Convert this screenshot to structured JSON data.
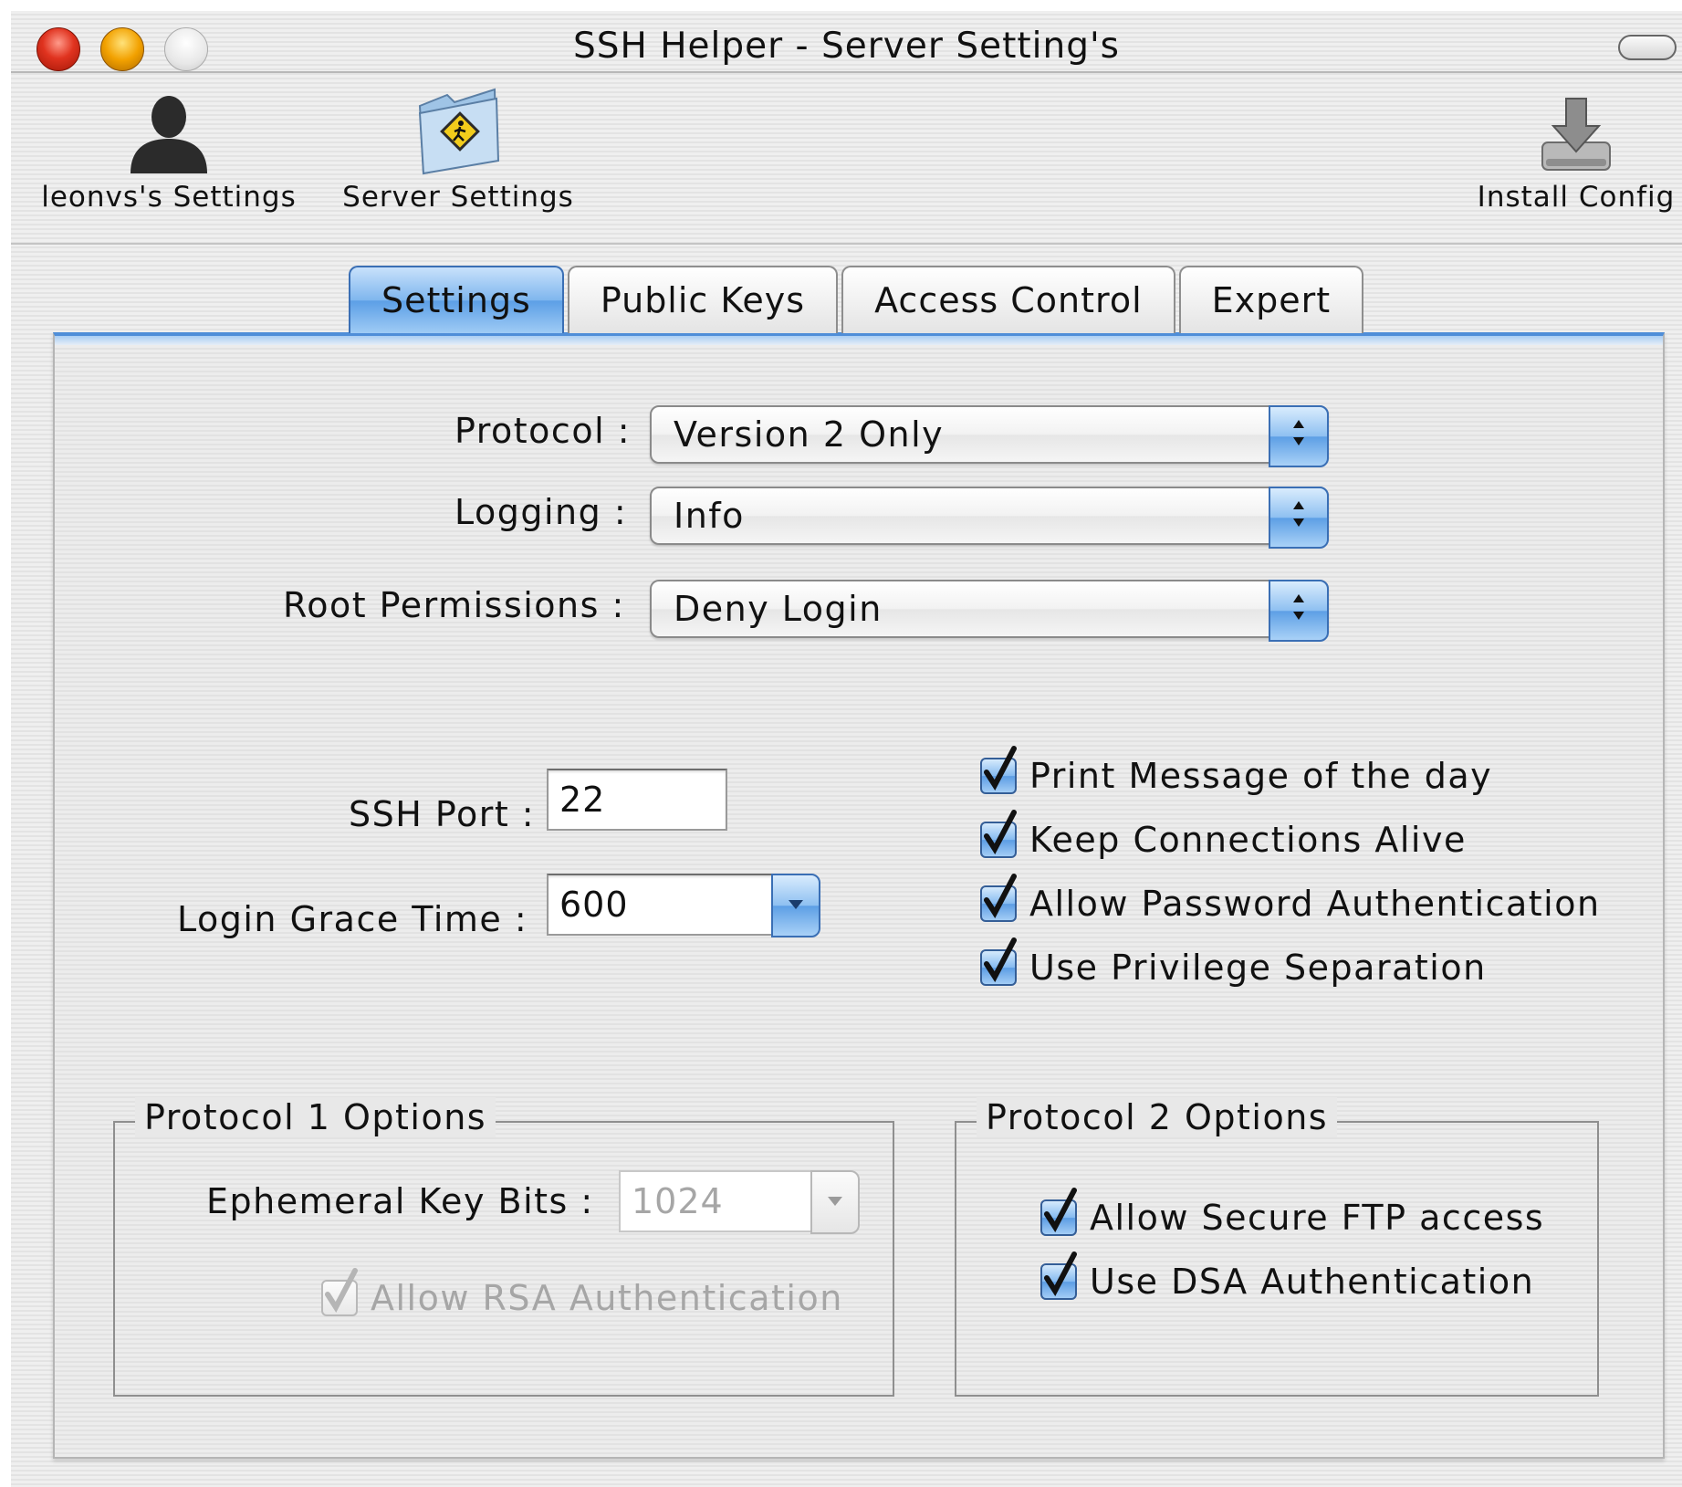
{
  "window": {
    "title": "SSH Helper - Server Setting's"
  },
  "toolbar": {
    "items": [
      {
        "label": "leonvs's Settings",
        "icon": "user-icon"
      },
      {
        "label": "Server Settings",
        "icon": "server-folder-icon"
      },
      {
        "label": "Install Config",
        "icon": "install-icon"
      }
    ]
  },
  "tabs": [
    {
      "label": "Settings",
      "active": true
    },
    {
      "label": "Public Keys",
      "active": false
    },
    {
      "label": "Access Control",
      "active": false
    },
    {
      "label": "Expert",
      "active": false
    }
  ],
  "settings": {
    "protocol": {
      "label": "Protocol :",
      "value": "Version 2 Only"
    },
    "logging": {
      "label": "Logging :",
      "value": "Info"
    },
    "root_permissions": {
      "label": "Root Permissions :",
      "value": "Deny Login"
    },
    "ssh_port": {
      "label": "SSH Port :",
      "value": "22"
    },
    "login_grace_time": {
      "label": "Login Grace Time :",
      "value": "600"
    },
    "checkboxes": [
      {
        "label": "Print Message of the day",
        "checked": true
      },
      {
        "label": "Keep Connections Alive",
        "checked": true
      },
      {
        "label": "Allow Password Authentication",
        "checked": true
      },
      {
        "label": "Use Privilege Separation",
        "checked": true
      }
    ]
  },
  "protocol1": {
    "title": "Protocol 1 Options",
    "ephemeral_key_bits": {
      "label": "Ephemeral Key Bits :",
      "value": "1024"
    },
    "allow_rsa": {
      "label": "Allow RSA Authentication",
      "checked": true,
      "enabled": false
    }
  },
  "protocol2": {
    "title": "Protocol 2 Options",
    "checkboxes": [
      {
        "label": "Allow Secure FTP access",
        "checked": true
      },
      {
        "label": "Use DSA Authentication",
        "checked": true
      }
    ]
  },
  "colors": {
    "accent_blue": "#5c9fe6",
    "close": "#e0331f",
    "minimize": "#f2a100"
  }
}
